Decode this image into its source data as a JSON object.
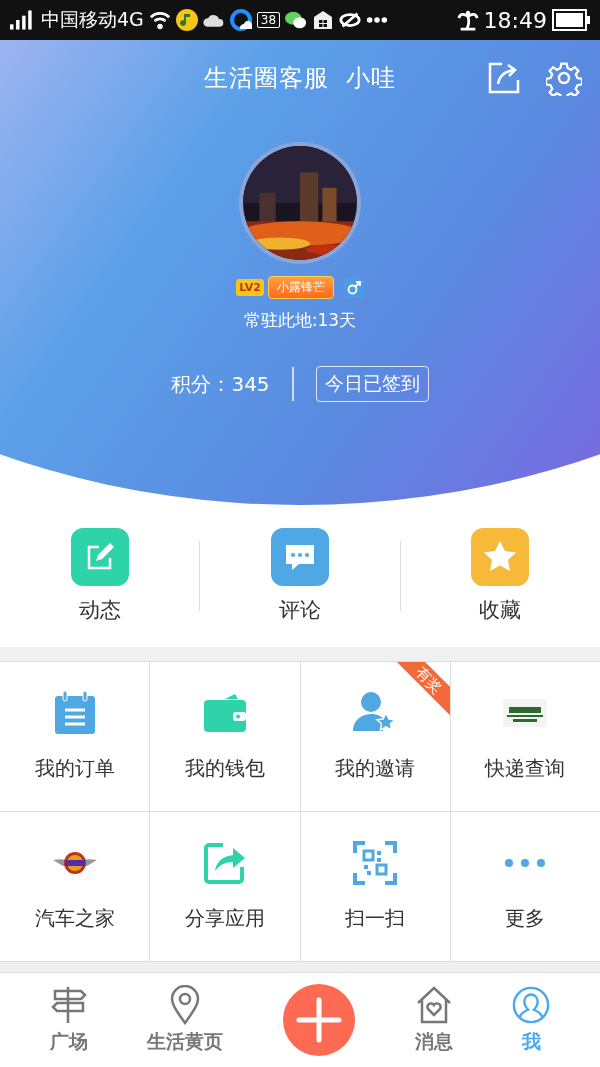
{
  "status_bar": {
    "carrier": "中国移动4G",
    "notification_count": "38",
    "time": "18:49"
  },
  "header": {
    "title": "生活圈客服  小哇",
    "level_badge": {
      "level": "LV2",
      "title": "小露锋芒"
    },
    "stay": "常驻此地:13天",
    "points": "积分：345",
    "checkin_button": "今日已签到"
  },
  "quick_actions": [
    {
      "kind": "post",
      "label": "动态",
      "color": "#2fd3aa"
    },
    {
      "kind": "comment",
      "label": "评论",
      "color": "#4fa7e3"
    },
    {
      "kind": "favorite",
      "label": "收藏",
      "color": "#f7b93a"
    }
  ],
  "grid": [
    {
      "kind": "order",
      "label": "我的订单"
    },
    {
      "kind": "wallet",
      "label": "我的钱包"
    },
    {
      "kind": "invite",
      "label": "我的邀请",
      "ribbon": "有奖"
    },
    {
      "kind": "express",
      "label": "快递查询"
    },
    {
      "kind": "car",
      "label": "汽车之家"
    },
    {
      "kind": "share",
      "label": "分享应用"
    },
    {
      "kind": "scan",
      "label": "扫一扫"
    },
    {
      "kind": "more",
      "label": "更多"
    }
  ],
  "center_button": {
    "kind": "add"
  },
  "tabs": [
    {
      "kind": "square",
      "label": "广场",
      "selected": false
    },
    {
      "kind": "pages",
      "label": "生活黄页",
      "selected": false
    },
    {
      "kind": "messages",
      "label": "消息",
      "selected": false
    },
    {
      "kind": "me",
      "label": "我",
      "selected": true
    }
  ]
}
